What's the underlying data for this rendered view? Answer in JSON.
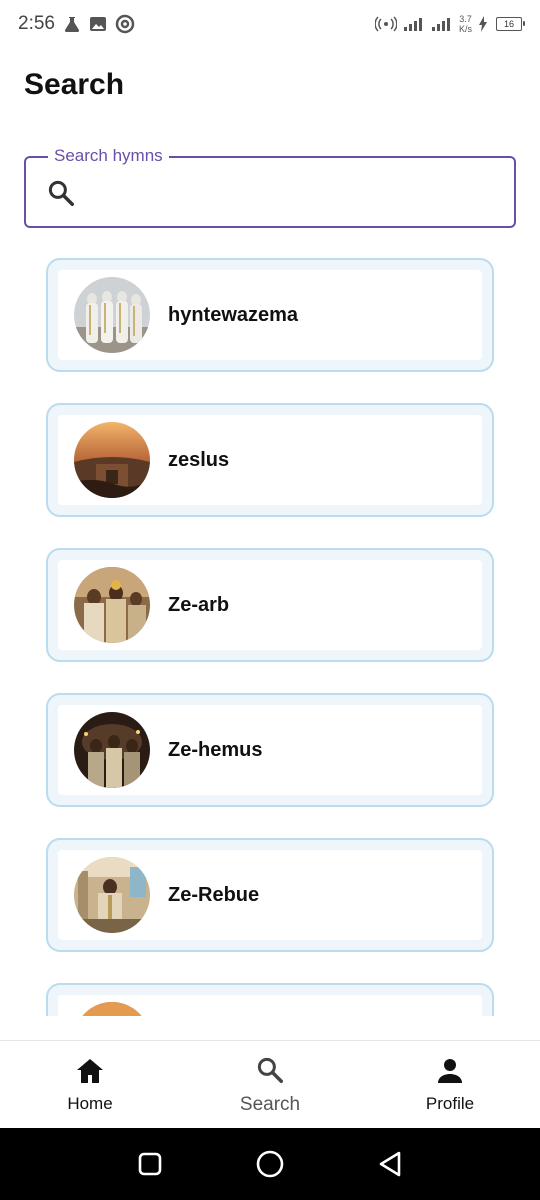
{
  "status_bar": {
    "time": "2:56",
    "net_speed_value": "3.7",
    "net_speed_unit": "K/s",
    "battery": "16"
  },
  "page": {
    "title": "Search"
  },
  "search": {
    "label": "Search hymns",
    "value": ""
  },
  "hymns": [
    {
      "title": "hyntewazema",
      "image": "white-robed-clergy"
    },
    {
      "title": "zeslus",
      "image": "rock-church-sunset"
    },
    {
      "title": "Ze-arb",
      "image": "procession-crowd"
    },
    {
      "title": "Ze-hemus",
      "image": "candlelit-gathering"
    },
    {
      "title": "Ze-Rebue",
      "image": "priest-in-church"
    },
    {
      "title": "",
      "image": "rock-church-sunset"
    }
  ],
  "bottom_nav": {
    "home": "Home",
    "search": "Search",
    "profile": "Profile"
  },
  "colors": {
    "accent": "#6a4fa8",
    "card_border": "#b9dcef",
    "card_bg": "#eef5fb"
  }
}
